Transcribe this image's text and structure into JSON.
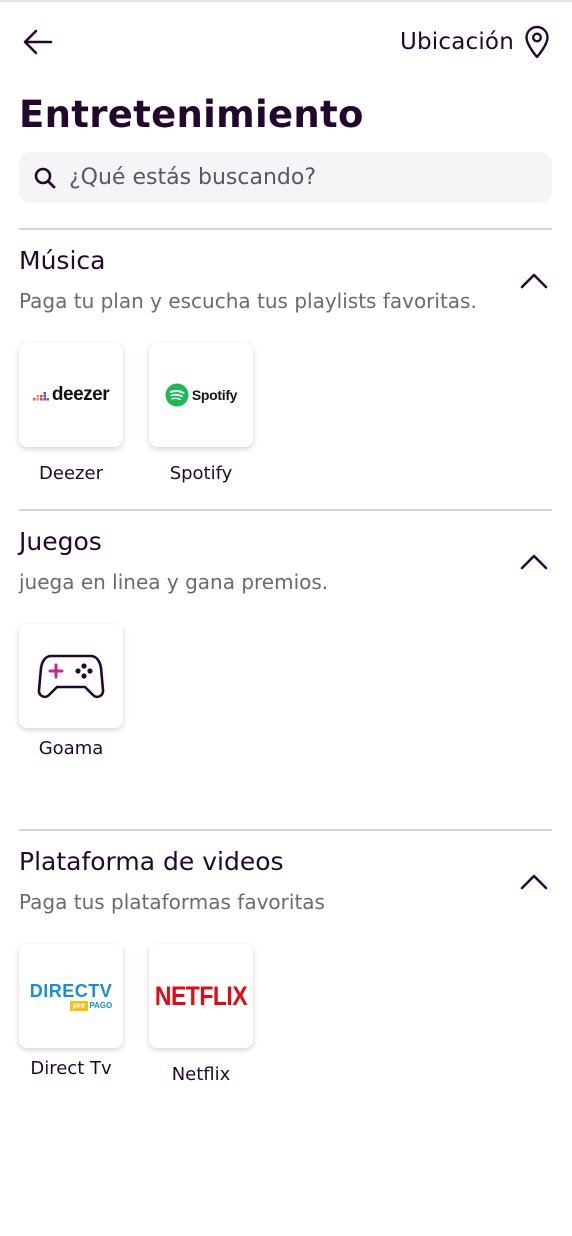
{
  "header": {
    "back_icon": "arrow-left-icon",
    "location_label": "Ubicación",
    "location_icon": "map-pin-icon"
  },
  "page_title": "Entretenimiento",
  "search": {
    "placeholder": "¿Qué estás buscando?",
    "value": "",
    "icon": "search-icon"
  },
  "sections": [
    {
      "title": "Música",
      "subtitle": "Paga tu plan y escucha tus playlists favoritas.",
      "expanded": true,
      "items": [
        {
          "label": "Deezer",
          "logo_text": "deezer"
        },
        {
          "label": "Spotify",
          "logo_text": "Spotify"
        }
      ]
    },
    {
      "title": "Juegos",
      "subtitle": " juega en linea y gana premios.",
      "expanded": true,
      "items": [
        {
          "label": "Goama",
          "icon": "gamepad-icon"
        }
      ]
    },
    {
      "title": "Plataforma de videos",
      "subtitle": "Paga tus plataformas favoritas",
      "expanded": true,
      "items": [
        {
          "label": "Direct Tv",
          "logo_text": "DIRECTV",
          "logo_subtext_1": "pre",
          "logo_subtext_2": "PAGO"
        },
        {
          "label": "Netflix",
          "logo_text": "NETFLIX"
        }
      ]
    }
  ],
  "colors": {
    "text_primary": "#23082e",
    "text_secondary": "#6b6a70",
    "search_bg": "#f5f5f7",
    "accent_magenta": "#c42a8c",
    "spotify_green": "#1db954",
    "netflix_red": "#e50914",
    "directv_blue": "#1a8fd6",
    "directv_yellow": "#f4c20d"
  }
}
